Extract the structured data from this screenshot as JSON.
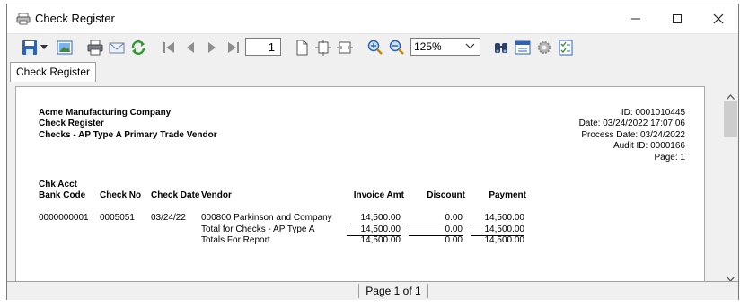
{
  "window": {
    "title": "Check Register"
  },
  "toolbar": {
    "page_number": "1",
    "zoom": "125%"
  },
  "tab": {
    "label": "Check Register"
  },
  "report": {
    "company": "Acme Manufacturing Company",
    "name": "Check Register",
    "subtitle": "Checks - AP Type A  Primary Trade Vendor",
    "id": "ID: 0001010445",
    "date": "Date: 03/24/2022 17:07:06",
    "process_date": "Process Date: 03/24/2022",
    "audit_id": "Audit ID: 0000166",
    "page": "Page: 1",
    "headers": {
      "chk_acct": "Chk Acct",
      "bank_code": "Bank Code",
      "check_no": "Check No",
      "check_date": "Check Date",
      "vendor": "Vendor",
      "invoice_amt": "Invoice Amt",
      "discount": "Discount",
      "payment": "Payment"
    },
    "row": {
      "bank_code": "0000000001",
      "check_no": "0005051",
      "check_date": "03/24/22",
      "vendor": "000800 Parkinson and Company",
      "invoice_amt": "14,500.00",
      "discount": "0.00",
      "payment": "14,500.00"
    },
    "total_checks": {
      "label": "Total for Checks - AP Type A",
      "invoice_amt": "14,500.00",
      "discount": "0.00",
      "payment": "14,500.00"
    },
    "total_report": {
      "label": "Totals For Report",
      "invoice_amt": "14,500.00",
      "discount": "0.00",
      "payment": "14,500.00"
    }
  },
  "status": {
    "page_info": "Page 1 of 1"
  }
}
